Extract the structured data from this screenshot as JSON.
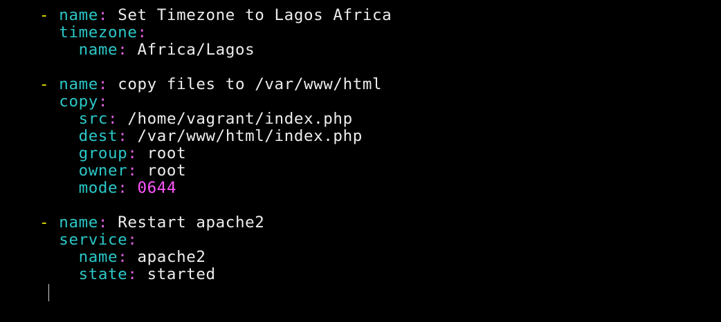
{
  "colors": {
    "background": "#000000",
    "dash": "#e6e600",
    "key": "#2bc8c8",
    "colon": "#e060e0",
    "value": "#ededed",
    "number": "#ff55ff"
  },
  "lines": [
    {
      "dash": "- ",
      "indent": "",
      "key": "name",
      "value": "Set Timezone to Lagos Africa"
    },
    {
      "dash": "",
      "indent": "  ",
      "key": "timezone",
      "value": ""
    },
    {
      "dash": "",
      "indent": "    ",
      "key": "name",
      "value": "Africa/Lagos"
    },
    {
      "dash": "",
      "indent": "",
      "key": "",
      "value": ""
    },
    {
      "dash": "- ",
      "indent": "",
      "key": "name",
      "value": "copy files to /var/www/html"
    },
    {
      "dash": "",
      "indent": "  ",
      "key": "copy",
      "value": ""
    },
    {
      "dash": "",
      "indent": "    ",
      "key": "src",
      "value": "/home/vagrant/index.php"
    },
    {
      "dash": "",
      "indent": "    ",
      "key": "dest",
      "value": "/var/www/html/index.php"
    },
    {
      "dash": "",
      "indent": "    ",
      "key": "group",
      "value": "root"
    },
    {
      "dash": "",
      "indent": "    ",
      "key": "owner",
      "value": "root"
    },
    {
      "dash": "",
      "indent": "    ",
      "key": "mode",
      "value": "0644",
      "numeric": true
    },
    {
      "dash": "",
      "indent": "",
      "key": "",
      "value": ""
    },
    {
      "dash": "- ",
      "indent": "",
      "key": "name",
      "value": "Restart apache2"
    },
    {
      "dash": "",
      "indent": "  ",
      "key": "service",
      "value": ""
    },
    {
      "dash": "",
      "indent": "    ",
      "key": "name",
      "value": "apache2"
    },
    {
      "dash": "",
      "indent": "    ",
      "key": "state",
      "value": "started"
    }
  ]
}
